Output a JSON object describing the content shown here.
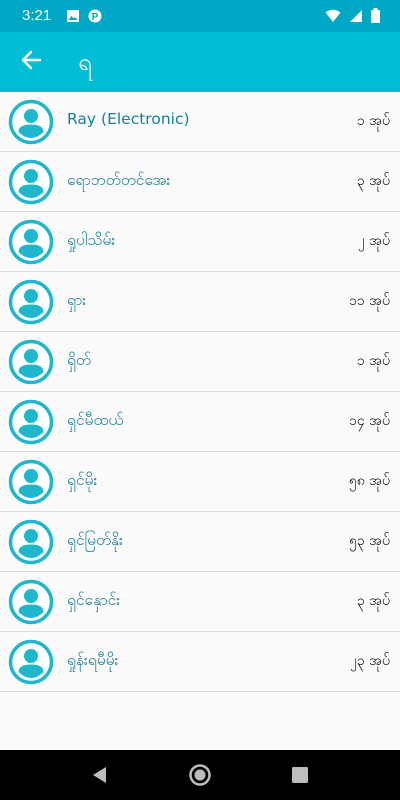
{
  "status": {
    "time": "3:21"
  },
  "app_bar": {
    "title": "ရ"
  },
  "rows": [
    {
      "name": "Ray (Electronic)",
      "count": "၁ အုပ်"
    },
    {
      "name": "ရောဘတ်တင်အေး",
      "count": "၃ အုပ်"
    },
    {
      "name": "ရှုပါသိမ်း",
      "count": "၂ အုပ်"
    },
    {
      "name": "ရှား",
      "count": "၁၁ အုပ်"
    },
    {
      "name": "ရှိတ်",
      "count": "၁ အုပ်"
    },
    {
      "name": "ရှင်မီထယ်",
      "count": "၁၄ အုပ်"
    },
    {
      "name": "ရှင်မိုး",
      "count": "၅၈ အုပ်"
    },
    {
      "name": "ရှင်မြတ်နိုး",
      "count": "၅၃ အုပ်"
    },
    {
      "name": "ရှင်နှောင်း",
      "count": "၃ အုပ်"
    },
    {
      "name": "ရှုန်းရမီမိုး",
      "count": "၂၃ အုပ်"
    }
  ],
  "icons": {
    "back": "arrow-left-icon",
    "avatar": "person-avatar-icon",
    "wifi": "wifi-icon",
    "signal": "signal-icon",
    "battery": "battery-icon"
  },
  "colors": {
    "status_bar": "#00a7c4",
    "app_bar": "#00bcd4",
    "avatar": "#1eb7cc",
    "name_text": "#16809a"
  }
}
